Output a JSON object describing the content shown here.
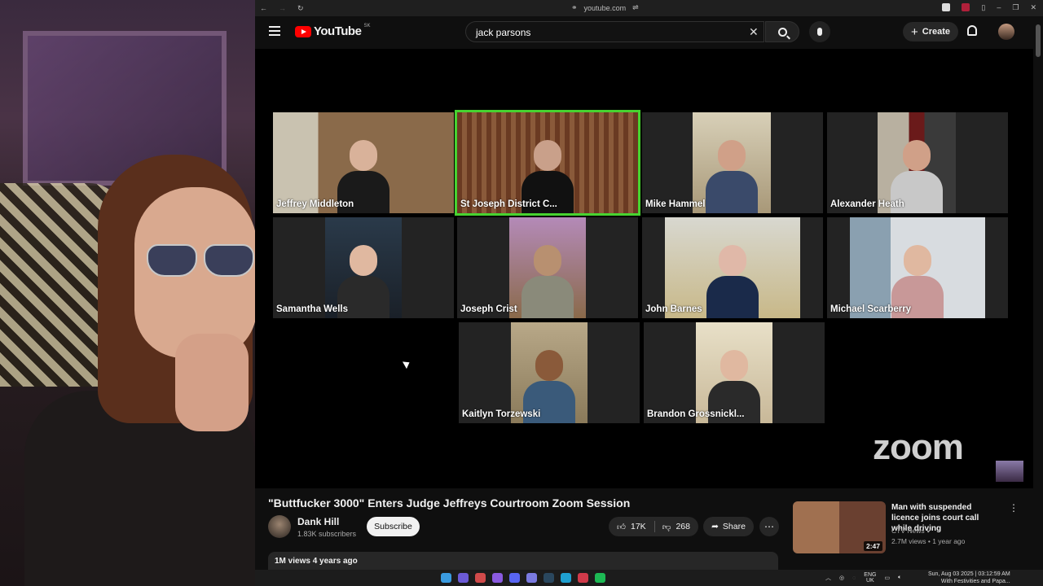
{
  "browser": {
    "url": "youtube.com"
  },
  "header": {
    "logo_text": "YouTube",
    "country_code": "SK",
    "search_query": "jack parsons",
    "create_label": "Create"
  },
  "zoom": {
    "logo_text": "zoom",
    "participants": [
      {
        "name": "Jeffrey Middleton",
        "active": false
      },
      {
        "name": "St Joseph District C...",
        "active": true
      },
      {
        "name": "Mike Hammel",
        "active": false
      },
      {
        "name": "Alexander Heath",
        "active": false
      },
      {
        "name": "Samantha Wells",
        "active": false
      },
      {
        "name": "Joseph Crist",
        "active": false
      },
      {
        "name": "John Barnes",
        "active": false
      },
      {
        "name": "Michael Scarberry",
        "active": false
      },
      {
        "name": "Kaitlyn Torzewski",
        "active": false
      },
      {
        "name": "Brandon Grossnickl...",
        "active": false
      }
    ]
  },
  "video": {
    "title": "\"Buttfucker 3000\" Enters Judge Jeffreys Courtroom Zoom Session",
    "channel_name": "Dank Hill",
    "subscribers": "1.83K subscribers",
    "subscribe_label": "Subscribe",
    "likes": "17K",
    "dislikes": "268",
    "share_label": "Share",
    "views_date": "1M views  4 years ago"
  },
  "recommendation": {
    "title": "Man with suspended licence joins court call while driving",
    "channel": "CTV News",
    "meta": "2.7M views • 1 year ago",
    "duration": "2:47"
  },
  "taskbar": {
    "lang_line1": "ENG",
    "lang_line2": "UK",
    "date_time": "Sun, Aug 03 2025 | 03:12:59 AM",
    "clock_sub": "With Festivities and Papa..."
  },
  "colors": {
    "active_speaker": "#47d330",
    "youtube_red": "#ff0000",
    "background": "#0f0f0f"
  }
}
